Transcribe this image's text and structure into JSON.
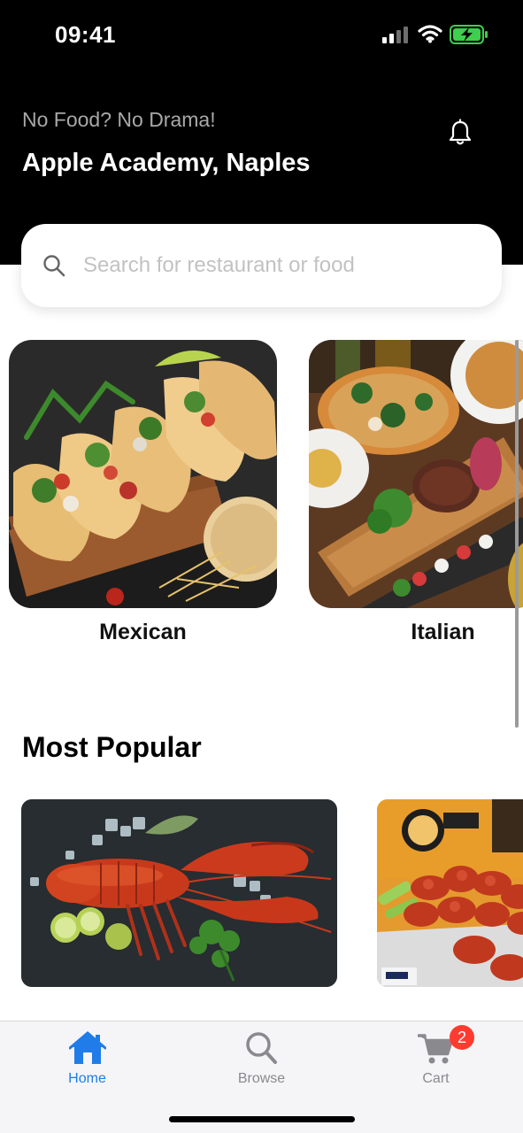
{
  "status_bar": {
    "time": "09:41"
  },
  "header": {
    "tagline": "No Food? No Drama!",
    "location": "Apple Academy, Naples"
  },
  "search": {
    "placeholder": "Search for restaurant or food"
  },
  "categories": [
    {
      "label": "Mexican",
      "image": "tacos-photo"
    },
    {
      "label": "Italian",
      "image": "italian-spread-photo"
    }
  ],
  "most_popular": {
    "title": "Most Popular",
    "items": [
      {
        "image": "lobster-photo"
      },
      {
        "image": "chicken-wings-photo"
      }
    ]
  },
  "tab_bar": {
    "tabs": [
      {
        "label": "Home",
        "icon": "house-icon",
        "active": true
      },
      {
        "label": "Browse",
        "icon": "magnifier-icon",
        "active": false
      },
      {
        "label": "Cart",
        "icon": "cart-icon",
        "active": false,
        "badge": "2"
      }
    ]
  },
  "colors": {
    "accent": "#1f7ce8",
    "badge": "#ff3b30",
    "header_bg": "#000000"
  }
}
